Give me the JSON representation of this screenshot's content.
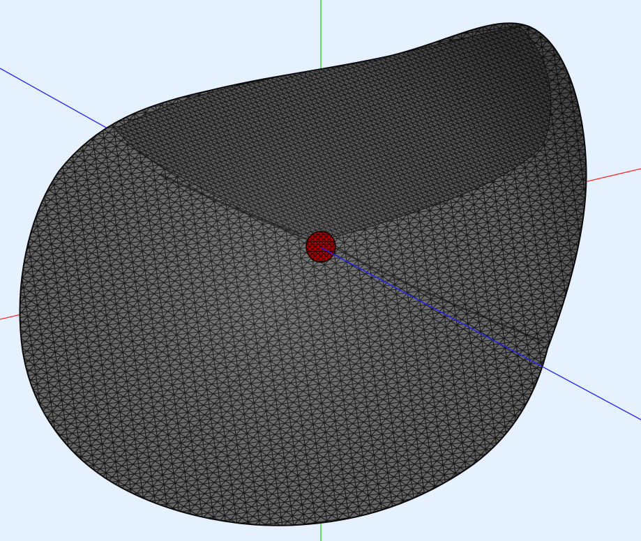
{
  "viewport": {
    "background": "#e6f1ff"
  },
  "axes": [
    {
      "name": "x-axis",
      "color": "#ff2a2a"
    },
    {
      "name": "y-axis",
      "color": "#19d419"
    },
    {
      "name": "z-axis",
      "color": "#2222ff"
    }
  ],
  "mesh": {
    "element_type": "triangle",
    "surface_color": "#6e6e6e",
    "edge_color": "#111111",
    "highlight_color": "#b30000"
  }
}
